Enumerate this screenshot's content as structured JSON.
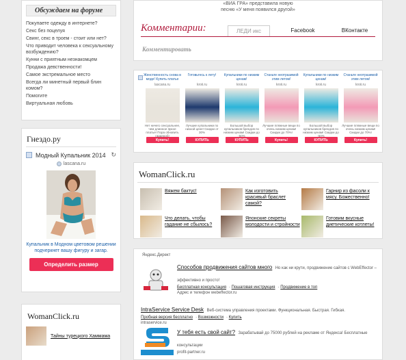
{
  "forum": {
    "title": "Обсуждаем на форуме",
    "items": [
      "Покупаете одежду в интернете?",
      "Секс без поцелуя",
      "Свинг, секс в троем - стоит или нет?",
      "Что приводит человека к сексуальному возбуждению?",
      "Кунни с приятным незнакомцем",
      "Продажа девственности!",
      "Самое экстремальное место",
      "Всегда ли минетный первый блин комом?",
      "Помогите",
      "Виртуальная любовь"
    ]
  },
  "nest": {
    "title": "Гнездо.ру",
    "ad_title": "Модный Купальник 2014",
    "ad_site": "lascana.ru",
    "ad_desc": "Купальник в Модном цветовом решении подчеркнет вашу фигуру и загар.",
    "ad_button": "Определить размер"
  },
  "womanclick_left": {
    "title": "WomanClick.ru",
    "item": "Тайны турецкого Хаммама"
  },
  "top_card": {
    "text_line1": "«ВИА ГРА» представила новую",
    "text_line2": "песню «У меня появился другой»"
  },
  "comments": {
    "title": "Комментарии:",
    "tab_active": "ЛЕДИ икс",
    "tab_facebook": "Facebook",
    "tab_vk": "ВКонтакте",
    "comment_link": "Комментировать"
  },
  "strip": {
    "items": [
      {
        "title": "Женственность снова в моде! Купить платье",
        "site": "lascana.ru",
        "desc": "Нет ничего сексуальнее, чем длинное яркое платье! Пора обновить гардероб!",
        "button": "Купить!",
        "color": "#e8e4dc"
      },
      {
        "title": "Готовьтесь к лету!",
        "site": "kroii.ru",
        "desc": "Лучшие купальники по низкой цене! Скидки от 30%",
        "button": "КУПИТЬ",
        "color": "#1e3a6e"
      },
      {
        "title": "Купальники по низким ценам!",
        "site": "kroii.ru",
        "desc": "Большой выбор купальников брендов по низким ценам! Скидки до -50%",
        "button": "КУПИТЬ",
        "color": "#2bb4d9"
      },
      {
        "title": "Станьте неотразимой этим летом!",
        "site": "kroii.ru",
        "desc": "Лучшие пляжные вещи по очень низким ценам! Скидки до 70%!",
        "button": "Купить!",
        "color": "#f39ab6"
      },
      {
        "title": "Купальники по низким ценам!",
        "site": "kroii.ru",
        "desc": "Большой выбор купальников брендов по низким ценам! Скидки до -50%",
        "button": "КУПИТЬ",
        "color": "#2bb4d9"
      },
      {
        "title": "Станьте неотразимой этим летом!",
        "site": "kroii.ru",
        "desc": "Лучшие пляжные вещи по очень низким ценам! Скидки до 70%!",
        "button": "Купить!",
        "color": "#f39ab6"
      }
    ]
  },
  "womanclick_right": {
    "title": "WomanClick.ru",
    "items": [
      {
        "text": "Вяжем бактус!",
        "color": "#c8bfb0"
      },
      {
        "text": "Как изготовить красивый браслет самой?",
        "color": "#b59278"
      },
      {
        "text": "Гарнир из фасоли к мясу. Божественно!",
        "color": "#b47a45"
      },
      {
        "text": "Что делать, чтобы гадание не сбылось?",
        "color": "#d9b98b"
      },
      {
        "text": "Японские секреты молодости и стройности",
        "color": "#7a5a4a"
      },
      {
        "text": "Готовим вкусные диетические котлеты!",
        "color": "#a8b96b"
      }
    ]
  },
  "direct": {
    "label": "Яндекс.Директ",
    "ad1": {
      "title": "Способов продвижения сайтов много",
      "text": "Но как ни крути, продвижение сайтов с WebEffector – эффективно и просто!",
      "links": [
        "Бесплатная консультация",
        "Пошаговая инструкция",
        "Продвижение в топ"
      ],
      "contact": "Адрес и телефон webeffector.ru"
    },
    "ad2": {
      "title": "IntraService Service Desk",
      "text": "Веб-система управления проектами. Функциональная. Быстрая. Гибкая.",
      "links": [
        "Пробная версия бесплатно",
        "Возможности",
        "Купить"
      ],
      "site": "intraservice.ru"
    },
    "ad3": {
      "title": "У тебя есть свой сайт?",
      "text": "Зарабатывай до 75000 рублей на рекламе от Яндекса! Бесплатные консультации",
      "site": "profit-partner.ru"
    }
  }
}
